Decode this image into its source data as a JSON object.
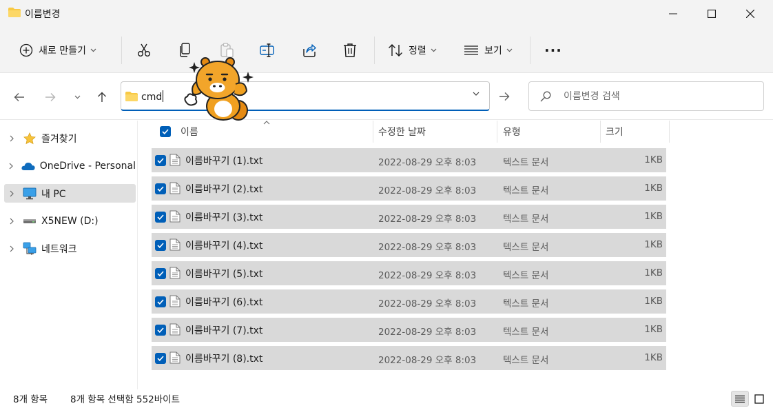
{
  "window": {
    "title": "이름변경"
  },
  "toolbar": {
    "new_label": "새로 만들기",
    "sort_label": "정렬",
    "view_label": "보기",
    "more_label": "···"
  },
  "address": {
    "path": "cmd"
  },
  "search": {
    "placeholder": "이름변경 검색"
  },
  "sidebar": {
    "items": [
      {
        "label": "즐겨찾기"
      },
      {
        "label": "OneDrive - Personal"
      },
      {
        "label": "내 PC"
      },
      {
        "label": "X5NEW (D:)"
      },
      {
        "label": "네트워크"
      }
    ]
  },
  "columns": {
    "name": "이름",
    "date": "수정한 날짜",
    "type": "유형",
    "size": "크기"
  },
  "files": [
    {
      "name": "이름바꾸기 (1).txt",
      "date": "2022-08-29 오후 8:03",
      "type": "텍스트 문서",
      "size": "1KB"
    },
    {
      "name": "이름바꾸기 (2).txt",
      "date": "2022-08-29 오후 8:03",
      "type": "텍스트 문서",
      "size": "1KB"
    },
    {
      "name": "이름바꾸기 (3).txt",
      "date": "2022-08-29 오후 8:03",
      "type": "텍스트 문서",
      "size": "1KB"
    },
    {
      "name": "이름바꾸기 (4).txt",
      "date": "2022-08-29 오후 8:03",
      "type": "텍스트 문서",
      "size": "1KB"
    },
    {
      "name": "이름바꾸기 (5).txt",
      "date": "2022-08-29 오후 8:03",
      "type": "텍스트 문서",
      "size": "1KB"
    },
    {
      "name": "이름바꾸기 (6).txt",
      "date": "2022-08-29 오후 8:03",
      "type": "텍스트 문서",
      "size": "1KB"
    },
    {
      "name": "이름바꾸기 (7).txt",
      "date": "2022-08-29 오후 8:03",
      "type": "텍스트 문서",
      "size": "1KB"
    },
    {
      "name": "이름바꾸기 (8).txt",
      "date": "2022-08-29 오후 8:03",
      "type": "텍스트 문서",
      "size": "1KB"
    }
  ],
  "status": {
    "count": "8개 항목",
    "selection": "8개 항목 선택함 552바이트"
  },
  "colors": {
    "accent": "#005fb8",
    "selected_row": "#d9d9d9",
    "folder": "#f8c945"
  }
}
